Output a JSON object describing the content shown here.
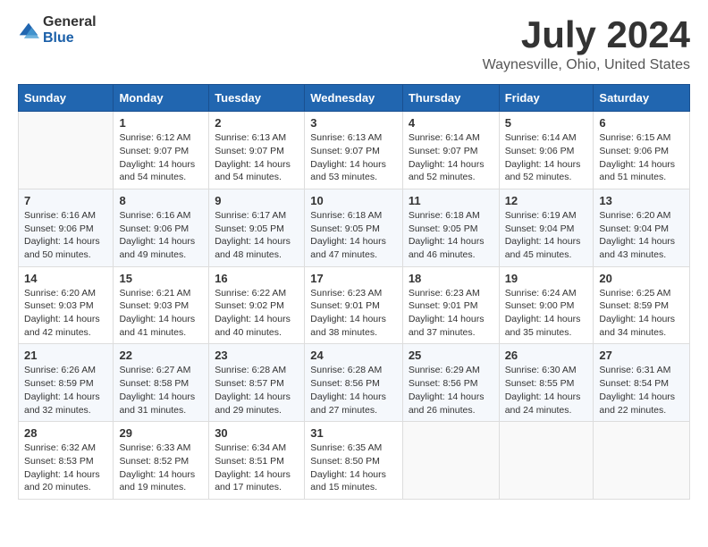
{
  "logo": {
    "general": "General",
    "blue": "Blue"
  },
  "title": "July 2024",
  "location": "Waynesville, Ohio, United States",
  "weekdays": [
    "Sunday",
    "Monday",
    "Tuesday",
    "Wednesday",
    "Thursday",
    "Friday",
    "Saturday"
  ],
  "weeks": [
    [
      {
        "day": "",
        "sunrise": "",
        "sunset": "",
        "daylight": ""
      },
      {
        "day": "1",
        "sunrise": "Sunrise: 6:12 AM",
        "sunset": "Sunset: 9:07 PM",
        "daylight": "Daylight: 14 hours and 54 minutes."
      },
      {
        "day": "2",
        "sunrise": "Sunrise: 6:13 AM",
        "sunset": "Sunset: 9:07 PM",
        "daylight": "Daylight: 14 hours and 54 minutes."
      },
      {
        "day": "3",
        "sunrise": "Sunrise: 6:13 AM",
        "sunset": "Sunset: 9:07 PM",
        "daylight": "Daylight: 14 hours and 53 minutes."
      },
      {
        "day": "4",
        "sunrise": "Sunrise: 6:14 AM",
        "sunset": "Sunset: 9:07 PM",
        "daylight": "Daylight: 14 hours and 52 minutes."
      },
      {
        "day": "5",
        "sunrise": "Sunrise: 6:14 AM",
        "sunset": "Sunset: 9:06 PM",
        "daylight": "Daylight: 14 hours and 52 minutes."
      },
      {
        "day": "6",
        "sunrise": "Sunrise: 6:15 AM",
        "sunset": "Sunset: 9:06 PM",
        "daylight": "Daylight: 14 hours and 51 minutes."
      }
    ],
    [
      {
        "day": "7",
        "sunrise": "Sunrise: 6:16 AM",
        "sunset": "Sunset: 9:06 PM",
        "daylight": "Daylight: 14 hours and 50 minutes."
      },
      {
        "day": "8",
        "sunrise": "Sunrise: 6:16 AM",
        "sunset": "Sunset: 9:06 PM",
        "daylight": "Daylight: 14 hours and 49 minutes."
      },
      {
        "day": "9",
        "sunrise": "Sunrise: 6:17 AM",
        "sunset": "Sunset: 9:05 PM",
        "daylight": "Daylight: 14 hours and 48 minutes."
      },
      {
        "day": "10",
        "sunrise": "Sunrise: 6:18 AM",
        "sunset": "Sunset: 9:05 PM",
        "daylight": "Daylight: 14 hours and 47 minutes."
      },
      {
        "day": "11",
        "sunrise": "Sunrise: 6:18 AM",
        "sunset": "Sunset: 9:05 PM",
        "daylight": "Daylight: 14 hours and 46 minutes."
      },
      {
        "day": "12",
        "sunrise": "Sunrise: 6:19 AM",
        "sunset": "Sunset: 9:04 PM",
        "daylight": "Daylight: 14 hours and 45 minutes."
      },
      {
        "day": "13",
        "sunrise": "Sunrise: 6:20 AM",
        "sunset": "Sunset: 9:04 PM",
        "daylight": "Daylight: 14 hours and 43 minutes."
      }
    ],
    [
      {
        "day": "14",
        "sunrise": "Sunrise: 6:20 AM",
        "sunset": "Sunset: 9:03 PM",
        "daylight": "Daylight: 14 hours and 42 minutes."
      },
      {
        "day": "15",
        "sunrise": "Sunrise: 6:21 AM",
        "sunset": "Sunset: 9:03 PM",
        "daylight": "Daylight: 14 hours and 41 minutes."
      },
      {
        "day": "16",
        "sunrise": "Sunrise: 6:22 AM",
        "sunset": "Sunset: 9:02 PM",
        "daylight": "Daylight: 14 hours and 40 minutes."
      },
      {
        "day": "17",
        "sunrise": "Sunrise: 6:23 AM",
        "sunset": "Sunset: 9:01 PM",
        "daylight": "Daylight: 14 hours and 38 minutes."
      },
      {
        "day": "18",
        "sunrise": "Sunrise: 6:23 AM",
        "sunset": "Sunset: 9:01 PM",
        "daylight": "Daylight: 14 hours and 37 minutes."
      },
      {
        "day": "19",
        "sunrise": "Sunrise: 6:24 AM",
        "sunset": "Sunset: 9:00 PM",
        "daylight": "Daylight: 14 hours and 35 minutes."
      },
      {
        "day": "20",
        "sunrise": "Sunrise: 6:25 AM",
        "sunset": "Sunset: 8:59 PM",
        "daylight": "Daylight: 14 hours and 34 minutes."
      }
    ],
    [
      {
        "day": "21",
        "sunrise": "Sunrise: 6:26 AM",
        "sunset": "Sunset: 8:59 PM",
        "daylight": "Daylight: 14 hours and 32 minutes."
      },
      {
        "day": "22",
        "sunrise": "Sunrise: 6:27 AM",
        "sunset": "Sunset: 8:58 PM",
        "daylight": "Daylight: 14 hours and 31 minutes."
      },
      {
        "day": "23",
        "sunrise": "Sunrise: 6:28 AM",
        "sunset": "Sunset: 8:57 PM",
        "daylight": "Daylight: 14 hours and 29 minutes."
      },
      {
        "day": "24",
        "sunrise": "Sunrise: 6:28 AM",
        "sunset": "Sunset: 8:56 PM",
        "daylight": "Daylight: 14 hours and 27 minutes."
      },
      {
        "day": "25",
        "sunrise": "Sunrise: 6:29 AM",
        "sunset": "Sunset: 8:56 PM",
        "daylight": "Daylight: 14 hours and 26 minutes."
      },
      {
        "day": "26",
        "sunrise": "Sunrise: 6:30 AM",
        "sunset": "Sunset: 8:55 PM",
        "daylight": "Daylight: 14 hours and 24 minutes."
      },
      {
        "day": "27",
        "sunrise": "Sunrise: 6:31 AM",
        "sunset": "Sunset: 8:54 PM",
        "daylight": "Daylight: 14 hours and 22 minutes."
      }
    ],
    [
      {
        "day": "28",
        "sunrise": "Sunrise: 6:32 AM",
        "sunset": "Sunset: 8:53 PM",
        "daylight": "Daylight: 14 hours and 20 minutes."
      },
      {
        "day": "29",
        "sunrise": "Sunrise: 6:33 AM",
        "sunset": "Sunset: 8:52 PM",
        "daylight": "Daylight: 14 hours and 19 minutes."
      },
      {
        "day": "30",
        "sunrise": "Sunrise: 6:34 AM",
        "sunset": "Sunset: 8:51 PM",
        "daylight": "Daylight: 14 hours and 17 minutes."
      },
      {
        "day": "31",
        "sunrise": "Sunrise: 6:35 AM",
        "sunset": "Sunset: 8:50 PM",
        "daylight": "Daylight: 14 hours and 15 minutes."
      },
      {
        "day": "",
        "sunrise": "",
        "sunset": "",
        "daylight": ""
      },
      {
        "day": "",
        "sunrise": "",
        "sunset": "",
        "daylight": ""
      },
      {
        "day": "",
        "sunrise": "",
        "sunset": "",
        "daylight": ""
      }
    ]
  ]
}
